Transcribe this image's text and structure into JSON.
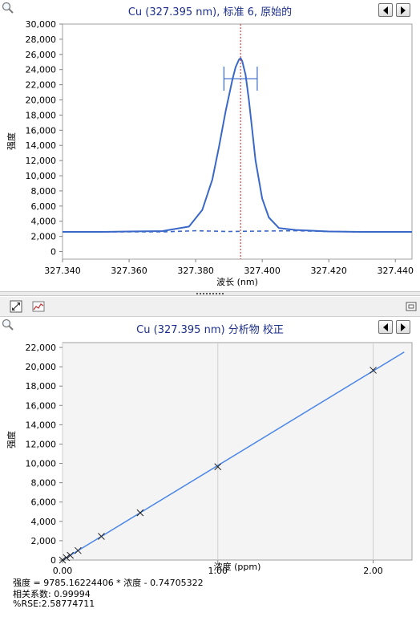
{
  "spectrum_panel": {
    "title": "Cu  (327.395  nm), 标准 6, 原始的",
    "icons": {
      "zoom": "magnifier-icon",
      "prev": "triangle-left-icon",
      "next": "triangle-right-icon"
    }
  },
  "calibration_panel": {
    "title": "Cu  (327.395  nm) 分析物 校正",
    "icons": {
      "zoom": "magnifier-icon",
      "prev": "triangle-left-icon",
      "next": "triangle-right-icon",
      "toolbar_a": "fit-view-icon",
      "toolbar_b": "chart-icon",
      "restore": "restore-window-icon"
    },
    "equation": "强度 = 9785.16224406 * 浓度 - 0.74705322",
    "correlation": "相关系数: 0.99994",
    "rse": "%RSE:2.58774711"
  },
  "chart_data": [
    {
      "type": "line",
      "title": "Cu  (327.395  nm), 标准 6, 原始的",
      "xlabel": "波长 (nm)",
      "ylabel": "强度",
      "xlim": [
        327.34,
        327.445
      ],
      "ylim": [
        -1000,
        30000
      ],
      "xticks": [
        "327.340",
        "327.360",
        "327.380",
        "327.400",
        "327.420",
        "327.440"
      ],
      "yticks": [
        "0",
        "2,000",
        "4,000",
        "6,000",
        "8,000",
        "10,000",
        "12,000",
        "14,000",
        "16,000",
        "18,000",
        "20,000",
        "22,000",
        "24,000",
        "26,000",
        "28,000",
        "30,000"
      ],
      "peak_marker_x": 327.3935,
      "integration_window": {
        "x_start": 327.3885,
        "x_end": 327.3985,
        "y": 22800
      },
      "series": [
        {
          "style": "solid",
          "x": [
            327.34,
            327.352,
            327.36,
            327.37,
            327.378,
            327.382,
            327.385,
            327.387,
            327.389,
            327.391,
            327.392,
            327.393,
            327.3935,
            327.394,
            327.395,
            327.396,
            327.397,
            327.398,
            327.4,
            327.402,
            327.405,
            327.41,
            327.42,
            327.43,
            327.445
          ],
          "y": [
            2600,
            2600,
            2650,
            2700,
            3300,
            5500,
            9500,
            13800,
            18500,
            22600,
            24300,
            25300,
            25500,
            25100,
            23300,
            20000,
            16000,
            12000,
            7000,
            4500,
            3100,
            2850,
            2650,
            2600,
            2600
          ]
        },
        {
          "style": "dashed",
          "x": [
            327.34,
            327.352,
            327.37,
            327.38,
            327.39,
            327.4,
            327.41,
            327.42,
            327.43,
            327.445
          ],
          "y": [
            2600,
            2600,
            2600,
            2750,
            2650,
            2700,
            2750,
            2650,
            2600,
            2600
          ]
        }
      ]
    },
    {
      "type": "scatter",
      "title": "Cu  (327.395  nm) 分析物 校正",
      "xlabel": "浓度 (ppm)",
      "ylabel": "强度",
      "xlim": [
        0,
        2.25
      ],
      "ylim": [
        0,
        22500
      ],
      "xticks": [
        "0.00",
        "1.00",
        "2.00"
      ],
      "yticks": [
        "0",
        "2,000",
        "4,000",
        "6,000",
        "8,000",
        "10,000",
        "12,000",
        "14,000",
        "16,000",
        "18,000",
        "20,000",
        "22,000"
      ],
      "points": {
        "x": [
          0.0,
          0.025,
          0.05,
          0.1,
          0.25,
          0.5,
          1.0,
          2.0
        ],
        "y": [
          0,
          245,
          490,
          980,
          2450,
          4890,
          9650,
          19640
        ]
      },
      "fit_line": {
        "x": [
          0.0,
          2.2
        ],
        "y": [
          -0.747,
          21527
        ]
      }
    }
  ]
}
